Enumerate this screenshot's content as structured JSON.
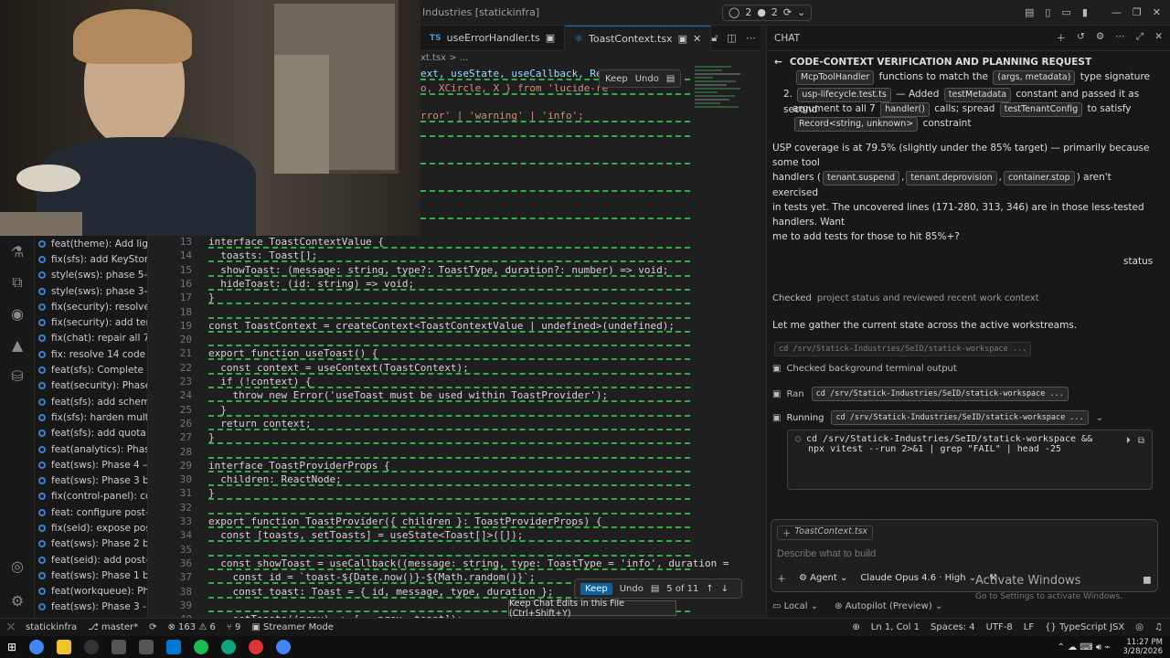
{
  "titlebar": {
    "crumb": "Industries [statickinfra]",
    "ports_count": "2",
    "sessions_count": "2"
  },
  "editor": {
    "tabs": [
      {
        "label": "useErrorHandler.ts",
        "active": false
      },
      {
        "label": "ToastContext.tsx",
        "active": true
      }
    ],
    "breadcrumb": "xt.tsx > ...",
    "top_fragments": [
      "ext, useState, useCallback, Rea",
      "o, XCircle, X } from 'lucide-re",
      "rror' | 'warning' | 'info';"
    ],
    "top_keep_label": "Keep",
    "top_undo_label": "Undo",
    "lines": [
      {
        "n": "13",
        "text": "interface ToastContextValue {"
      },
      {
        "n": "14",
        "text": "  toasts: Toast[];"
      },
      {
        "n": "15",
        "text": "  showToast: (message: string, type?: ToastType, duration?: number) => void;"
      },
      {
        "n": "16",
        "text": "  hideToast: (id: string) => void;"
      },
      {
        "n": "17",
        "text": "}"
      },
      {
        "n": "18",
        "text": ""
      },
      {
        "n": "19",
        "text": "const ToastContext = createContext<ToastContextValue | undefined>(undefined);"
      },
      {
        "n": "20",
        "text": ""
      },
      {
        "n": "21",
        "text": "export function useToast() {"
      },
      {
        "n": "22",
        "text": "  const context = useContext(ToastContext);"
      },
      {
        "n": "23",
        "text": "  if (!context) {"
      },
      {
        "n": "24",
        "text": "    throw new Error('useToast must be used within ToastProvider');"
      },
      {
        "n": "25",
        "text": "  }"
      },
      {
        "n": "26",
        "text": "  return context;"
      },
      {
        "n": "27",
        "text": "}"
      },
      {
        "n": "28",
        "text": ""
      },
      {
        "n": "29",
        "text": "interface ToastProviderProps {"
      },
      {
        "n": "30",
        "text": "  children: ReactNode;"
      },
      {
        "n": "31",
        "text": "}"
      },
      {
        "n": "32",
        "text": ""
      },
      {
        "n": "33",
        "text": "export function ToastProvider({ children }: ToastProviderProps) {"
      },
      {
        "n": "34",
        "text": "  const [toasts, setToasts] = useState<Toast[]>([]);"
      },
      {
        "n": "35",
        "text": ""
      },
      {
        "n": "36",
        "text": "  const showToast = useCallback((message: string, type: ToastType = 'info', duration ="
      },
      {
        "n": "37",
        "text": "    const id = `toast-${Date.now()}-${Math.random()}`;"
      },
      {
        "n": "38",
        "text": "    const toast: Toast = { id, message, type, duration };"
      },
      {
        "n": "39",
        "text": ""
      },
      {
        "n": "40",
        "text": "    setToasts((prev) => [...prev, toast]);"
      }
    ],
    "inline": {
      "keep": "Keep",
      "undo": "Undo",
      "counter": "5 of 11"
    },
    "tooltip": "Keep Chat Edits in this File (Ctrl+Shift+Y)"
  },
  "sidebar": {
    "commits": [
      "feat(theme): Add ligh...",
      "fix(sfs): add KeyStora...",
      "style(sws): phase 5-6 ...",
      "style(sws): phase 3-4 ...",
      "fix(security): resolve ...",
      "fix(security): add ten...",
      "fix(chat): repair all 7 ...",
      "fix: resolve 14 code r...",
      "feat(sfs): Complete S...",
      "feat(security): Phase ...",
      "feat(sfs): add schema...",
      "fix(sfs): harden multi-...",
      "feat(sfs): add quota s...",
      "feat(analytics): Phase...",
      "feat(sws): Phase 4 — ...",
      "feat(sws): Phase 3 ba...",
      "fix(control-panel): co...",
      "feat: configure post-l...",
      "fix(seid): expose post...",
      "feat(sws): Phase 2 ba...",
      "feat(seid): add post-l...",
      "feat(sws): Phase 1 ba...",
      "feat(workqueue): Pha...",
      "feat(sws): Phase 3 - ..."
    ]
  },
  "chat": {
    "header_label": "CHAT",
    "title": "CODE-CONTEXT VERIFICATION AND PLANNING REQUEST",
    "list": {
      "l1_chip": "McpToolHandler",
      "l1_mid": "functions to match the",
      "l1_chip2": "(args, metadata)",
      "l1_end": "type signature",
      "l2_num": "2.",
      "l2_chip": "usp-lifecycle.test.ts",
      "l2_mid": "— Added",
      "l2_chip2": "testMetadata",
      "l2_end": "constant and passed it as second",
      "l3_start": "argument to all 7",
      "l3_chip": "handler()",
      "l3_mid": "calls; spread",
      "l3_chip2": "testTenantConfig",
      "l3_end": "to satisfy",
      "l4_chip": "Record<string, unknown>",
      "l4_end": "constraint"
    },
    "coverage": {
      "p1": "USP coverage is at 79.5% (slightly under the 85% target) — primarily because some tool",
      "p2a": "handlers (",
      "chip1": "tenant.suspend",
      "chip2": "tenant.deprovision",
      "chip3": "container.stop",
      "p2b": ") aren't exercised",
      "p3": "in tests yet. The uncovered lines (171-280, 313, 346) are in those less-tested handlers. Want",
      "p4": "me to add tests for those to hit 85%+?"
    },
    "status_label": "status",
    "checked_label": "Checked",
    "checked_text": "project status and reviewed recent work context",
    "gather_text": "Let me gather the current state across the active workstreams.",
    "faded_cmd": "cd /srv/Statick-Industries/SeID/statick-workspace ...",
    "bg_output": "Checked background terminal output",
    "ran_label": "Ran",
    "ran_cmd": "cd /srv/Statick-Industries/SeID/statick-workspace ...",
    "running_label": "Running",
    "running_cmd": "cd /srv/Statick-Industries/SeID/statick-workspace ...",
    "term_line1": "cd /srv/Statick-Industries/SeID/statick-workspace &&",
    "term_line2": "npx vitest --run 2>&1 | grep \"FAIL\" | head -25",
    "attachment": "ToastContext.tsx",
    "placeholder": "Describe what to build",
    "agent_label": "Agent",
    "model_label": "Claude Opus 4.6 · High",
    "local_label": "Local",
    "autopilot_label": "Autopilot (Preview)",
    "activate_title": "Activate Windows",
    "activate_sub": "Go to Settings to activate Windows."
  },
  "statusbar": {
    "branch_repo": "statickinfra",
    "branch": "master*",
    "errors": "163",
    "warnings": "6",
    "ports": "9",
    "mode": "Streamer Mode",
    "position": "Ln 1, Col 1",
    "spaces": "Spaces: 4",
    "encoding": "UTF-8",
    "eol": "LF",
    "language": "TypeScript JSX"
  },
  "taskbar": {
    "time": "11:27 PM",
    "date": "3/28/2026"
  }
}
